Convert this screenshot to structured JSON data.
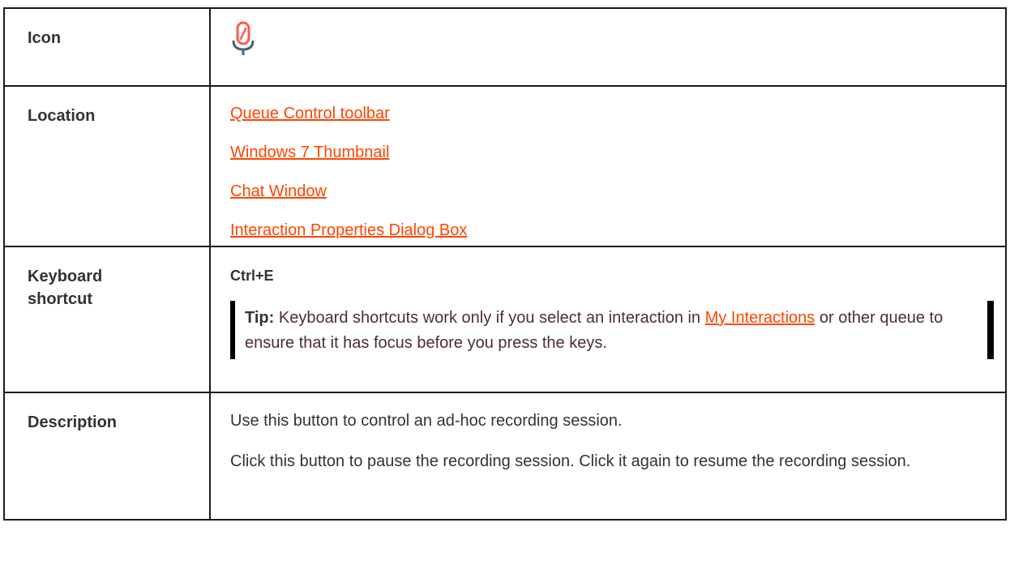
{
  "rows": {
    "icon": {
      "label": "Icon",
      "icon_name": "microphone-pause-icon"
    },
    "location": {
      "label": "Location",
      "links": [
        "Queue Control toolbar",
        "Windows 7 Thumbnail",
        "Chat Window",
        "Interaction Properties Dialog Box"
      ]
    },
    "keyboard": {
      "label_line1": "Keyboard",
      "label_line2": "shortcut",
      "shortcut": "Ctrl+E",
      "tip": {
        "label": "Tip:",
        "text_before": " Keyboard shortcuts work only if you select an interaction in ",
        "link": "My Interactions",
        "text_after": " or other queue to ensure that it has focus before you press the keys."
      }
    },
    "description": {
      "label": "Description",
      "paragraphs": [
        "Use this button to control an ad-hoc recording session.",
        "Click this button to pause the recording session. Click it again to resume the recording session."
      ]
    }
  },
  "colors": {
    "link": "#ff4500",
    "icon_accent": "#ff5a4a",
    "icon_stand": "#4a6478",
    "border": "#1a1a1a"
  }
}
